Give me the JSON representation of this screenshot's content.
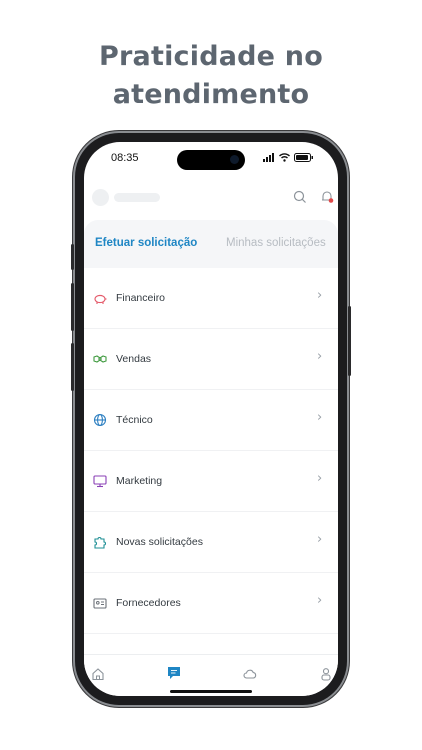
{
  "headline": [
    "Praticidade no",
    "atendimento"
  ],
  "status_bar": {
    "time": "08:35"
  },
  "tabs": [
    {
      "label": "Efetuar solicitação",
      "active": true
    },
    {
      "label": "Minhas solicitações",
      "active": false
    }
  ],
  "items": [
    {
      "label": "Financeiro",
      "icon": "piggy-bank-icon",
      "color": "#e45a6a"
    },
    {
      "label": "Vendas",
      "icon": "handshake-icon",
      "color": "#3f9a3f"
    },
    {
      "label": "Técnico",
      "icon": "globe-icon",
      "color": "#2d7fc1"
    },
    {
      "label": "Marketing",
      "icon": "monitor-icon",
      "color": "#8a3fb6"
    },
    {
      "label": "Novas solicitações",
      "icon": "puzzle-icon",
      "color": "#1f8f95"
    },
    {
      "label": "Fornecedores",
      "icon": "id-card-icon",
      "color": "#6b7178"
    }
  ],
  "bottom_nav": [
    {
      "icon": "home-icon",
      "active": false
    },
    {
      "icon": "chat-icon",
      "active": true
    },
    {
      "icon": "cloud-icon",
      "active": false
    },
    {
      "icon": "user-icon",
      "active": false
    }
  ],
  "colors": {
    "accent": "#1f86c4",
    "headline": "#5d6670"
  }
}
